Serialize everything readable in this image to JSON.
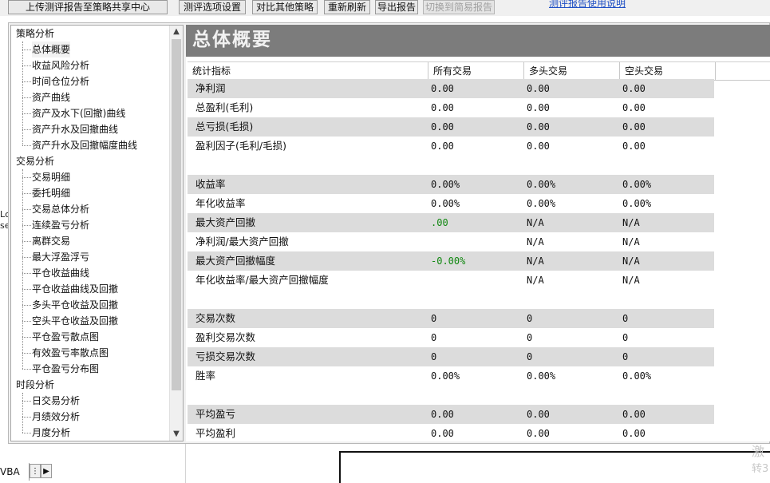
{
  "toolbar": {
    "upload_label": "上传测评报告至策略共享中心",
    "options_label": "测评选项设置",
    "compare_label": "对比其他策略",
    "refresh_label": "重新刷新",
    "export_label": "导出报告",
    "simple_label": "切换到简易报告",
    "help_label": "测评报告使用说明"
  },
  "tree": {
    "groups": [
      {
        "label": "策略分析",
        "items": [
          "总体概要",
          "收益风险分析",
          "时间仓位分析",
          "资产曲线",
          "资产及水下(回撤)曲线",
          "资产升水及回撤曲线",
          "资产升水及回撤幅度曲线"
        ]
      },
      {
        "label": "交易分析",
        "items": [
          "交易明细",
          "委托明细",
          "交易总体分析",
          "连续盈亏分析",
          "离群交易",
          "最大浮盈浮亏",
          "平仓收益曲线",
          "平仓收益曲线及回撤",
          "多头平仓收益及回撤",
          "空头平仓收益及回撤",
          "平仓盈亏散点图",
          "有效盈亏率散点图",
          "平仓盈亏分布图"
        ]
      },
      {
        "label": "时段分析",
        "items": [
          "日交易分析",
          "月绩效分析",
          "月度分析"
        ]
      }
    ]
  },
  "content": {
    "title": "总体概要",
    "columns": [
      "统计指标",
      "所有交易",
      "多头交易",
      "空头交易"
    ],
    "rows": [
      {
        "label": "净利润",
        "all": "0.00",
        "long": "0.00",
        "short": "0.00"
      },
      {
        "label": "总盈利(毛利)",
        "all": "0.00",
        "long": "0.00",
        "short": "0.00"
      },
      {
        "label": "总亏损(毛损)",
        "all": "0.00",
        "long": "0.00",
        "short": "0.00"
      },
      {
        "label": "盈利因子(毛利/毛损)",
        "all": "0.00",
        "long": "0.00",
        "short": "0.00"
      },
      {
        "label": "收益率",
        "all": "0.00%",
        "long": "0.00%",
        "short": "0.00%"
      },
      {
        "label": "年化收益率",
        "all": "0.00%",
        "long": "0.00%",
        "short": "0.00%"
      },
      {
        "label": "最大资产回撤",
        "all": ".00",
        "long": "N/A",
        "short": "N/A"
      },
      {
        "label": "净利润/最大资产回撤",
        "all": "",
        "long": "N/A",
        "short": "N/A"
      },
      {
        "label": "最大资产回撤幅度",
        "all": "-0.00%",
        "long": "N/A",
        "short": "N/A"
      },
      {
        "label": "年化收益率/最大资产回撤幅度",
        "all": "",
        "long": "N/A",
        "short": "N/A"
      },
      {
        "label": "交易次数",
        "all": "0",
        "long": "0",
        "short": "0"
      },
      {
        "label": "盈利交易次数",
        "all": "0",
        "long": "0",
        "short": "0"
      },
      {
        "label": "亏损交易次数",
        "all": "0",
        "long": "0",
        "short": "0"
      },
      {
        "label": "胜率",
        "all": "0.00%",
        "long": "0.00%",
        "short": "0.00%"
      },
      {
        "label": "平均盈亏",
        "all": "0.00",
        "long": "0.00",
        "short": "0.00"
      },
      {
        "label": "平均盈利",
        "all": "0.00",
        "long": "0.00",
        "short": "0.00"
      }
    ]
  },
  "background": {
    "sheet_tab": "VBA",
    "left_frag_1": "Lc",
    "left_frag_2": "se",
    "watermark_1": "激",
    "watermark_2": "转3"
  },
  "colors": {
    "banner": "#7c7c7c",
    "row_shade": "#dcdcdc",
    "positive_text": "#118811",
    "link": "#1f4fc4"
  }
}
